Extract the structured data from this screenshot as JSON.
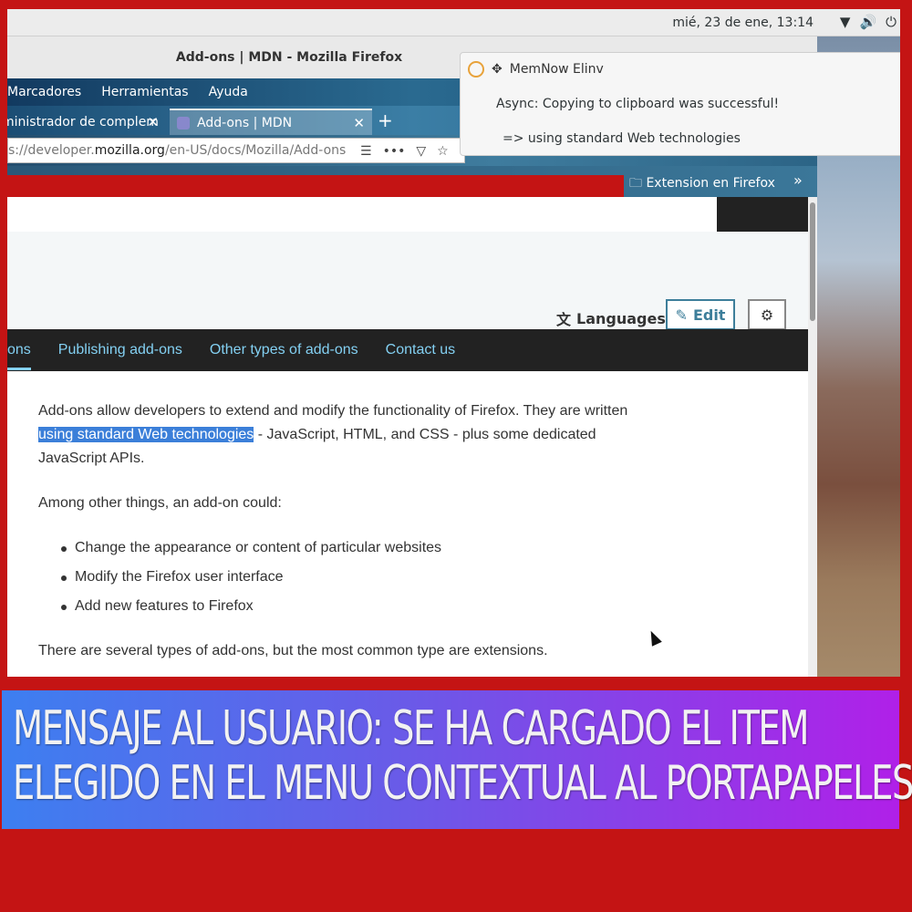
{
  "topbar": {
    "clock": "mié, 23 de ene, 13:14",
    "icons": [
      "wifi-icon",
      "volume-icon",
      "power-icon"
    ]
  },
  "window": {
    "title": "Add-ons | MDN - Mozilla Firefox"
  },
  "menubar": {
    "items": [
      "Marcadores",
      "Herramientas",
      "Ayuda"
    ]
  },
  "tabs": [
    {
      "label": "ministrador de complem"
    },
    {
      "label": "Add-ons | MDN"
    }
  ],
  "urlbar": {
    "prefix": "s://developer.",
    "domain": "mozilla.org",
    "path": "/en-US/docs/Mozilla/Add-ons"
  },
  "bookmarks": {
    "folder_label": "Extension en Firefox"
  },
  "page": {
    "languages_label": "Languages",
    "edit_label": "Edit",
    "subnav": [
      "ons",
      "Publishing add-ons",
      "Other types of add-ons",
      "Contact us"
    ],
    "para1_pre": "Add-ons allow developers to extend and modify the functionality of Firefox. They are written ",
    "para1_highlight": "using standard Web technologies",
    "para1_post": " - JavaScript, HTML, and CSS - plus some dedicated JavaScript APIs.",
    "para2": "Among other things, an add-on could:",
    "bullets": [
      "Change the appearance or content of particular websites",
      "Modify the Firefox user interface",
      "Add new features to Firefox"
    ],
    "para3": "There are several types of add-ons, but the most common type are extensions."
  },
  "notification": {
    "app_name": "MemNow Elinv",
    "title": "Async: Copying to clipboard was successful!",
    "body": "=> using standard Web technologies"
  },
  "banner": {
    "line1": "MENSAJE AL USUARIO: SE HA CARGADO EL ITEM",
    "line2": "ELEGIDO EN EL MENU CONTEXTUAL AL PORTAPAPELES"
  },
  "colors": {
    "desktop_bg": "#c41414",
    "link": "#83d0f2",
    "highlight": "#3b7fd9",
    "edit_accent": "#3d7e9a"
  }
}
